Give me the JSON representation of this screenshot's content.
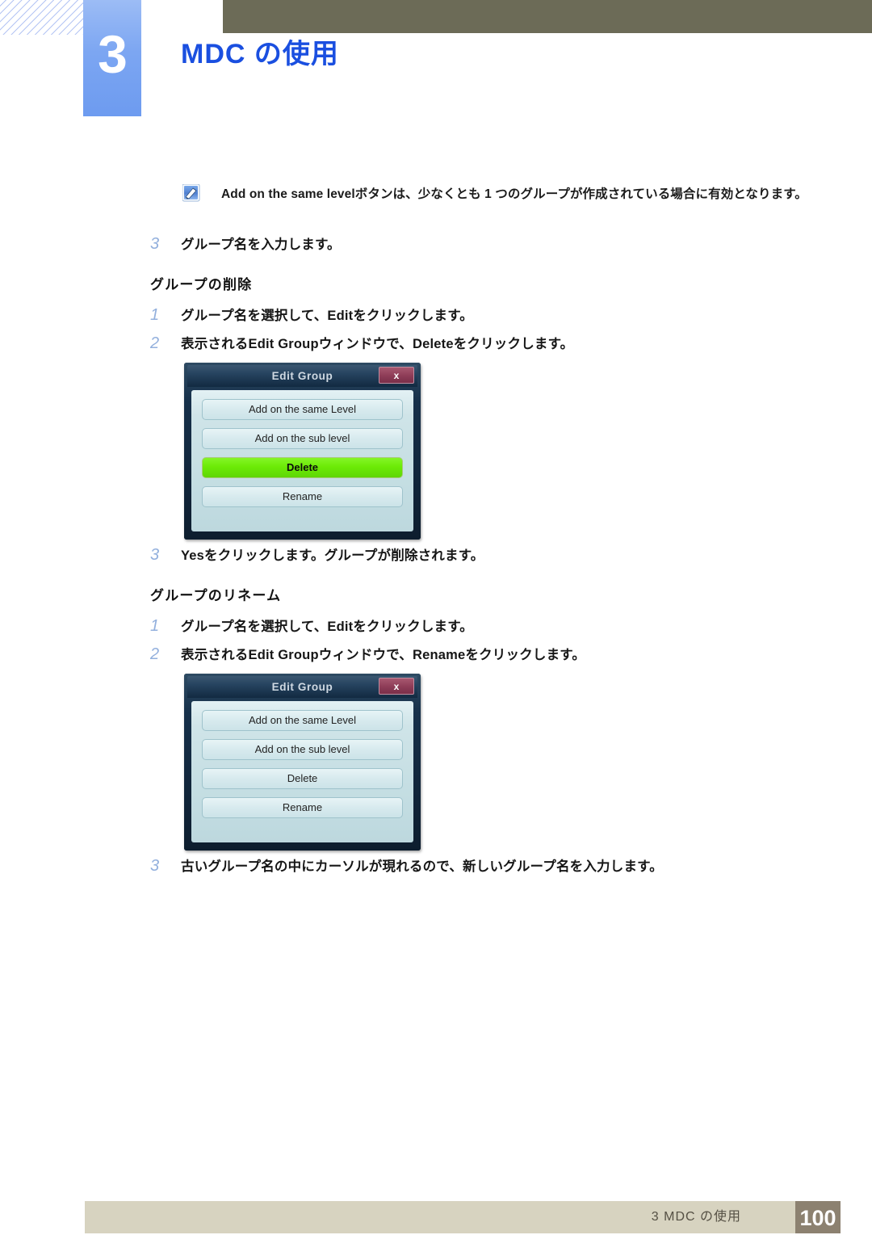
{
  "header": {
    "chapter_number": "3",
    "chapter_title": "MDC の使用"
  },
  "note": {
    "icon": "note-pencil-icon",
    "text": "Add on the same levelボタンは、少なくとも 1 つのグループが作成されている場合に有効となります。"
  },
  "steps_add": [
    {
      "num": "3",
      "text": "グループ名を入力します。"
    }
  ],
  "section_delete": {
    "heading": "グループの削除",
    "steps": [
      {
        "num": "1",
        "text": "グループ名を選択して、Editをクリックします。"
      },
      {
        "num": "2",
        "text": "表示されるEdit Groupウィンドウで、Deleteをクリックします。"
      },
      {
        "num": "3",
        "text": "Yesをクリックします。グループが削除されます。"
      }
    ]
  },
  "section_rename": {
    "heading": "グループのリネーム",
    "steps": [
      {
        "num": "1",
        "text": "グループ名を選択して、Editをクリックします。"
      },
      {
        "num": "2",
        "text": "表示されるEdit Groupウィンドウで、Renameをクリックします。"
      },
      {
        "num": "3",
        "text": "古いグループ名の中にカーソルが現れるので、新しいグループ名を入力します。"
      }
    ]
  },
  "dialog_delete": {
    "title": "Edit Group",
    "close_label": "x",
    "buttons": [
      {
        "label": "Add on the same Level",
        "highlighted": false
      },
      {
        "label": "Add on the sub level",
        "highlighted": false
      },
      {
        "label": "Delete",
        "highlighted": true
      },
      {
        "label": "Rename",
        "highlighted": false
      }
    ]
  },
  "dialog_rename": {
    "title": "Edit Group",
    "close_label": "x",
    "buttons": [
      {
        "label": "Add on the same Level",
        "highlighted": false
      },
      {
        "label": "Add on the sub level",
        "highlighted": false
      },
      {
        "label": "Delete",
        "highlighted": false
      },
      {
        "label": "Rename",
        "highlighted": false
      }
    ]
  },
  "footer": {
    "text": "3 MDC の使用",
    "page_number": "100"
  },
  "colors": {
    "top_bar": "#6c6b57",
    "chapter_tab": "#7ca6f2",
    "chapter_title": "#1a4fe0",
    "step_number": "#93b0dd",
    "dialog_frame": "#13293c",
    "dialog_body": "#cfe4e8",
    "highlight_green": "#6ceb06",
    "close_button": "#8d3c57",
    "footer_bar": "#d7d3c0",
    "footer_page_box": "#8c8170"
  }
}
